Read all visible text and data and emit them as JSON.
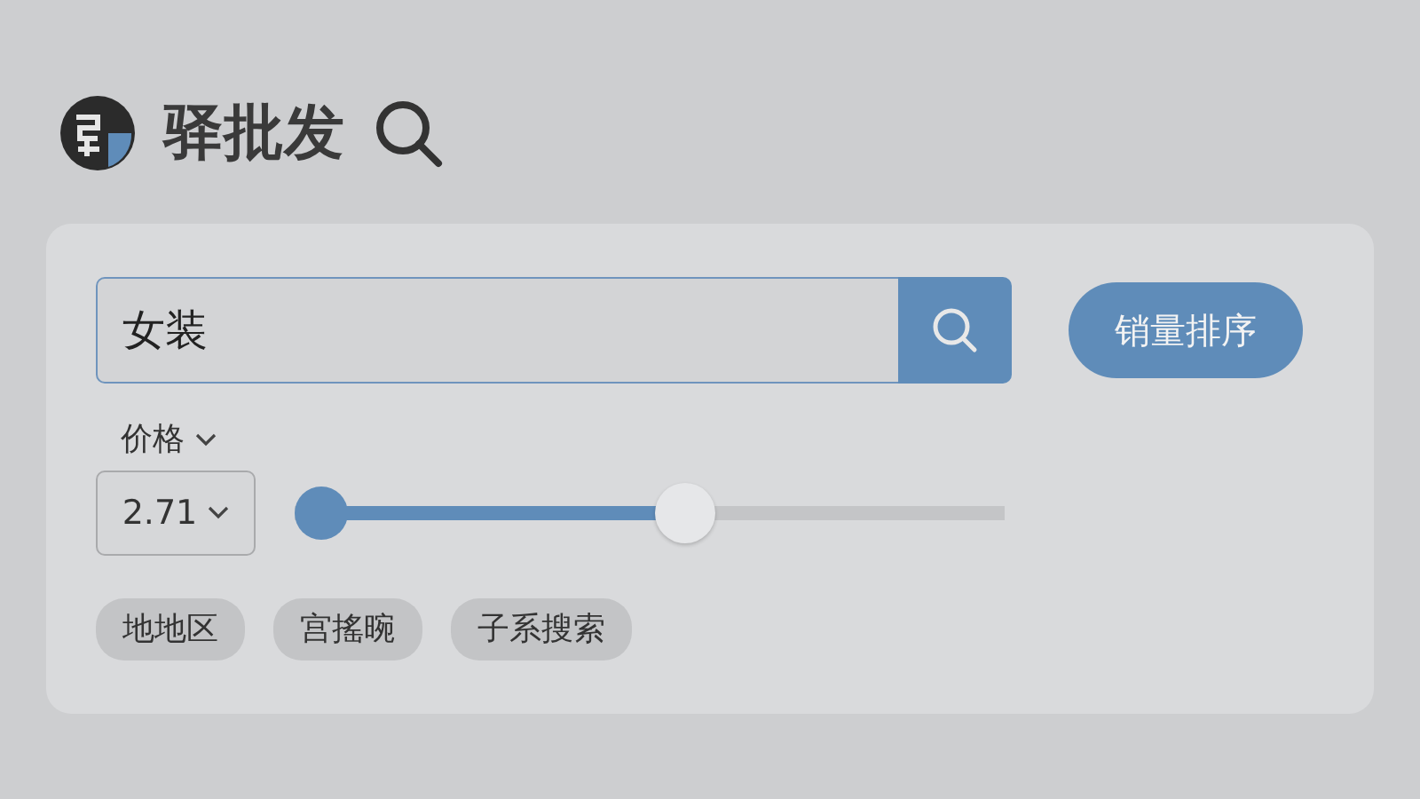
{
  "header": {
    "title": "驿批发"
  },
  "search": {
    "value": "女装"
  },
  "sort_button": {
    "label": "销量排序"
  },
  "price": {
    "label": "价格",
    "value": "2.71",
    "level": 0.55
  },
  "tags": [
    {
      "label": "地地区"
    },
    {
      "label": "宫搖晼"
    },
    {
      "label": "子系搜索"
    }
  ]
}
